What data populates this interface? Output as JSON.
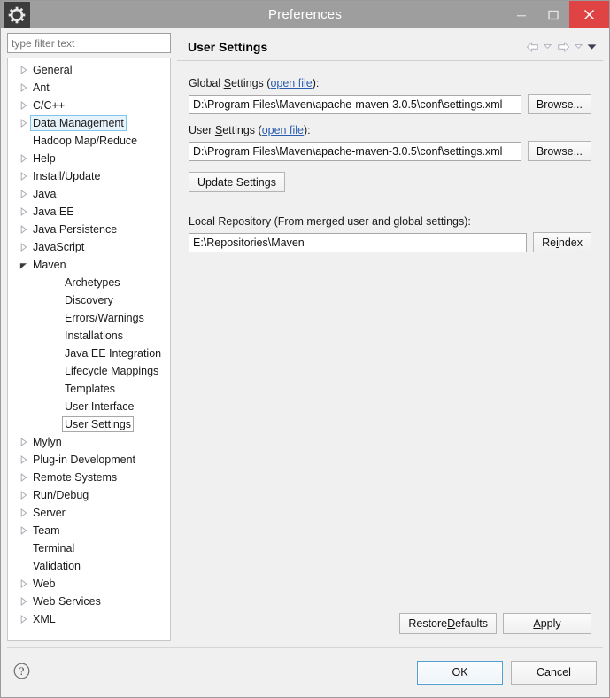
{
  "window": {
    "title": "Preferences",
    "app_icon": "gear-icon",
    "controls": {
      "minimize": "minimize-icon",
      "maximize": "maximize-icon",
      "close": "close-icon"
    },
    "close_color": "#e04343",
    "titlebar_color": "#9e9e9e"
  },
  "filter": {
    "value": "",
    "placeholder": "type filter text"
  },
  "tree": {
    "items": [
      {
        "label": "General",
        "indent": 0,
        "arrow": "collapsed",
        "state": "normal"
      },
      {
        "label": "Ant",
        "indent": 0,
        "arrow": "collapsed",
        "state": "normal"
      },
      {
        "label": "C/C++",
        "indent": 0,
        "arrow": "collapsed",
        "state": "normal"
      },
      {
        "label": "Data Management",
        "indent": 0,
        "arrow": "collapsed",
        "state": "highlighted"
      },
      {
        "label": "Hadoop Map/Reduce",
        "indent": 0,
        "arrow": "none",
        "state": "normal"
      },
      {
        "label": "Help",
        "indent": 0,
        "arrow": "collapsed",
        "state": "normal"
      },
      {
        "label": "Install/Update",
        "indent": 0,
        "arrow": "collapsed",
        "state": "normal"
      },
      {
        "label": "Java",
        "indent": 0,
        "arrow": "collapsed",
        "state": "normal"
      },
      {
        "label": "Java EE",
        "indent": 0,
        "arrow": "collapsed",
        "state": "normal"
      },
      {
        "label": "Java Persistence",
        "indent": 0,
        "arrow": "collapsed",
        "state": "normal"
      },
      {
        "label": "JavaScript",
        "indent": 0,
        "arrow": "collapsed",
        "state": "normal"
      },
      {
        "label": "Maven",
        "indent": 0,
        "arrow": "expanded",
        "state": "normal"
      },
      {
        "label": "Archetypes",
        "indent": 1,
        "arrow": "none",
        "state": "normal"
      },
      {
        "label": "Discovery",
        "indent": 1,
        "arrow": "none",
        "state": "normal"
      },
      {
        "label": "Errors/Warnings",
        "indent": 1,
        "arrow": "none",
        "state": "normal"
      },
      {
        "label": "Installations",
        "indent": 1,
        "arrow": "none",
        "state": "normal"
      },
      {
        "label": "Java EE Integration",
        "indent": 1,
        "arrow": "none",
        "state": "normal"
      },
      {
        "label": "Lifecycle Mappings",
        "indent": 1,
        "arrow": "none",
        "state": "normal"
      },
      {
        "label": "Templates",
        "indent": 1,
        "arrow": "none",
        "state": "normal"
      },
      {
        "label": "User Interface",
        "indent": 1,
        "arrow": "none",
        "state": "normal"
      },
      {
        "label": "User Settings",
        "indent": 1,
        "arrow": "none",
        "state": "selected"
      },
      {
        "label": "Mylyn",
        "indent": 0,
        "arrow": "collapsed",
        "state": "normal"
      },
      {
        "label": "Plug-in Development",
        "indent": 0,
        "arrow": "collapsed",
        "state": "normal"
      },
      {
        "label": "Remote Systems",
        "indent": 0,
        "arrow": "collapsed",
        "state": "normal"
      },
      {
        "label": "Run/Debug",
        "indent": 0,
        "arrow": "collapsed",
        "state": "normal"
      },
      {
        "label": "Server",
        "indent": 0,
        "arrow": "collapsed",
        "state": "normal"
      },
      {
        "label": "Team",
        "indent": 0,
        "arrow": "collapsed",
        "state": "normal"
      },
      {
        "label": "Terminal",
        "indent": 0,
        "arrow": "none",
        "state": "normal"
      },
      {
        "label": "Validation",
        "indent": 0,
        "arrow": "none",
        "state": "normal"
      },
      {
        "label": "Web",
        "indent": 0,
        "arrow": "collapsed",
        "state": "normal"
      },
      {
        "label": "Web Services",
        "indent": 0,
        "arrow": "collapsed",
        "state": "normal"
      },
      {
        "label": "XML",
        "indent": 0,
        "arrow": "collapsed",
        "state": "normal"
      }
    ],
    "highlight_border_color": "#7fc5e8",
    "highlight_fill_color": "#e8f4fb"
  },
  "page": {
    "title": "User Settings",
    "nav": {
      "back": "back-arrow-icon",
      "back_menu": "chevron-down-icon",
      "forward": "forward-arrow-icon",
      "forward_menu": "chevron-down-icon",
      "view_menu": "view-menu-icon"
    },
    "global_settings": {
      "label_prefix": "Global ",
      "label_mnemonic": "S",
      "label_rest": "ettings ",
      "link": "open file",
      "label_suffix": ":",
      "value": "D:\\Program Files\\Maven\\apache-maven-3.0.5\\conf\\settings.xml",
      "browse_label": "Browse..."
    },
    "user_settings": {
      "label_prefix": "User ",
      "label_mnemonic": "S",
      "label_rest": "ettings ",
      "link": "open file",
      "label_suffix": ":",
      "value": "D:\\Program Files\\Maven\\apache-maven-3.0.5\\conf\\settings.xml",
      "browse_label": "Browse..."
    },
    "update_settings_label": "Update Settings",
    "local_repository": {
      "label": "Local Repository (From merged user and global settings):",
      "value": "E:\\Repositories\\Maven",
      "reindex_prefix": "Re",
      "reindex_mnemonic": "i",
      "reindex_rest": "ndex"
    },
    "restore_defaults": {
      "prefix": "Restore ",
      "mnemonic": "D",
      "rest": "efaults"
    },
    "apply": {
      "prefix": "",
      "mnemonic": "A",
      "rest": "pply"
    },
    "link_color": "#2a5db0"
  },
  "footer": {
    "help_icon": "help-question-icon",
    "ok_label": "OK",
    "cancel_label": "Cancel",
    "focus_color": "#4f9ed4"
  }
}
